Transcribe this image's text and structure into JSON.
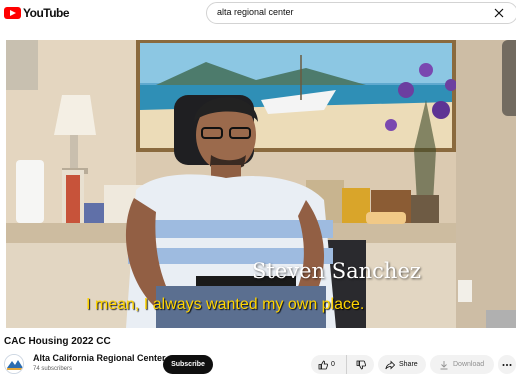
{
  "header": {
    "logo_text": "YouTube",
    "search_value": "alta regional center"
  },
  "player": {
    "name_caption": "Steven Sanchez",
    "subtitle": "I mean, I always wanted my own place."
  },
  "video": {
    "title": "CAC Housing 2022 CC"
  },
  "channel": {
    "name": "Alta California Regional Center",
    "subscribers": "74 subscribers",
    "subscribe_label": "Subscribe"
  },
  "actions": {
    "like_count": "0",
    "share_label": "Share",
    "download_label": "Download"
  },
  "colors": {
    "brand_red": "#ff0000",
    "subtitle_yellow": "#ffd400",
    "subscribe_bg": "#0f0f0f"
  },
  "icons": [
    "youtube-logo-icon",
    "clear-icon",
    "like-icon",
    "dislike-icon",
    "share-icon",
    "download-icon",
    "more-icon"
  ]
}
